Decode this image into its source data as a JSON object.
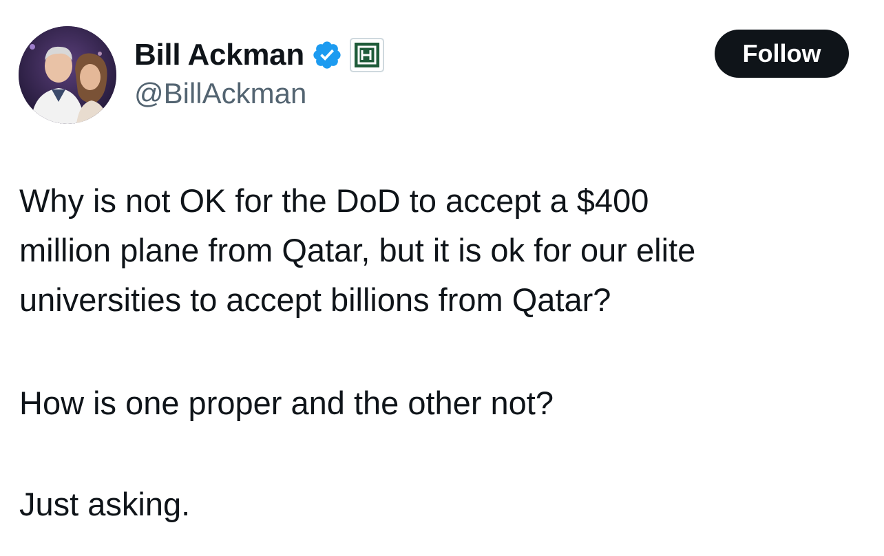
{
  "author": {
    "display_name": "Bill Ackman",
    "handle": "@BillAckman",
    "verified_badge_icon": "verified-check-icon",
    "affiliation_icon": "pershing-square-logo-icon",
    "badge_color": "#1d9bf0",
    "affiliation_color": "#1f5c3a"
  },
  "actions": {
    "follow_label": "Follow"
  },
  "tweet": {
    "paragraphs": [
      {
        "lines": [
          "Why is not OK for the DoD to accept a $400",
          "million plane from Qatar, but it is ok for our elite",
          "universities to accept billions from Qatar?"
        ]
      },
      {
        "lines": [
          "How is one proper and the other not?"
        ]
      },
      {
        "lines": [
          "Just asking."
        ]
      }
    ]
  }
}
